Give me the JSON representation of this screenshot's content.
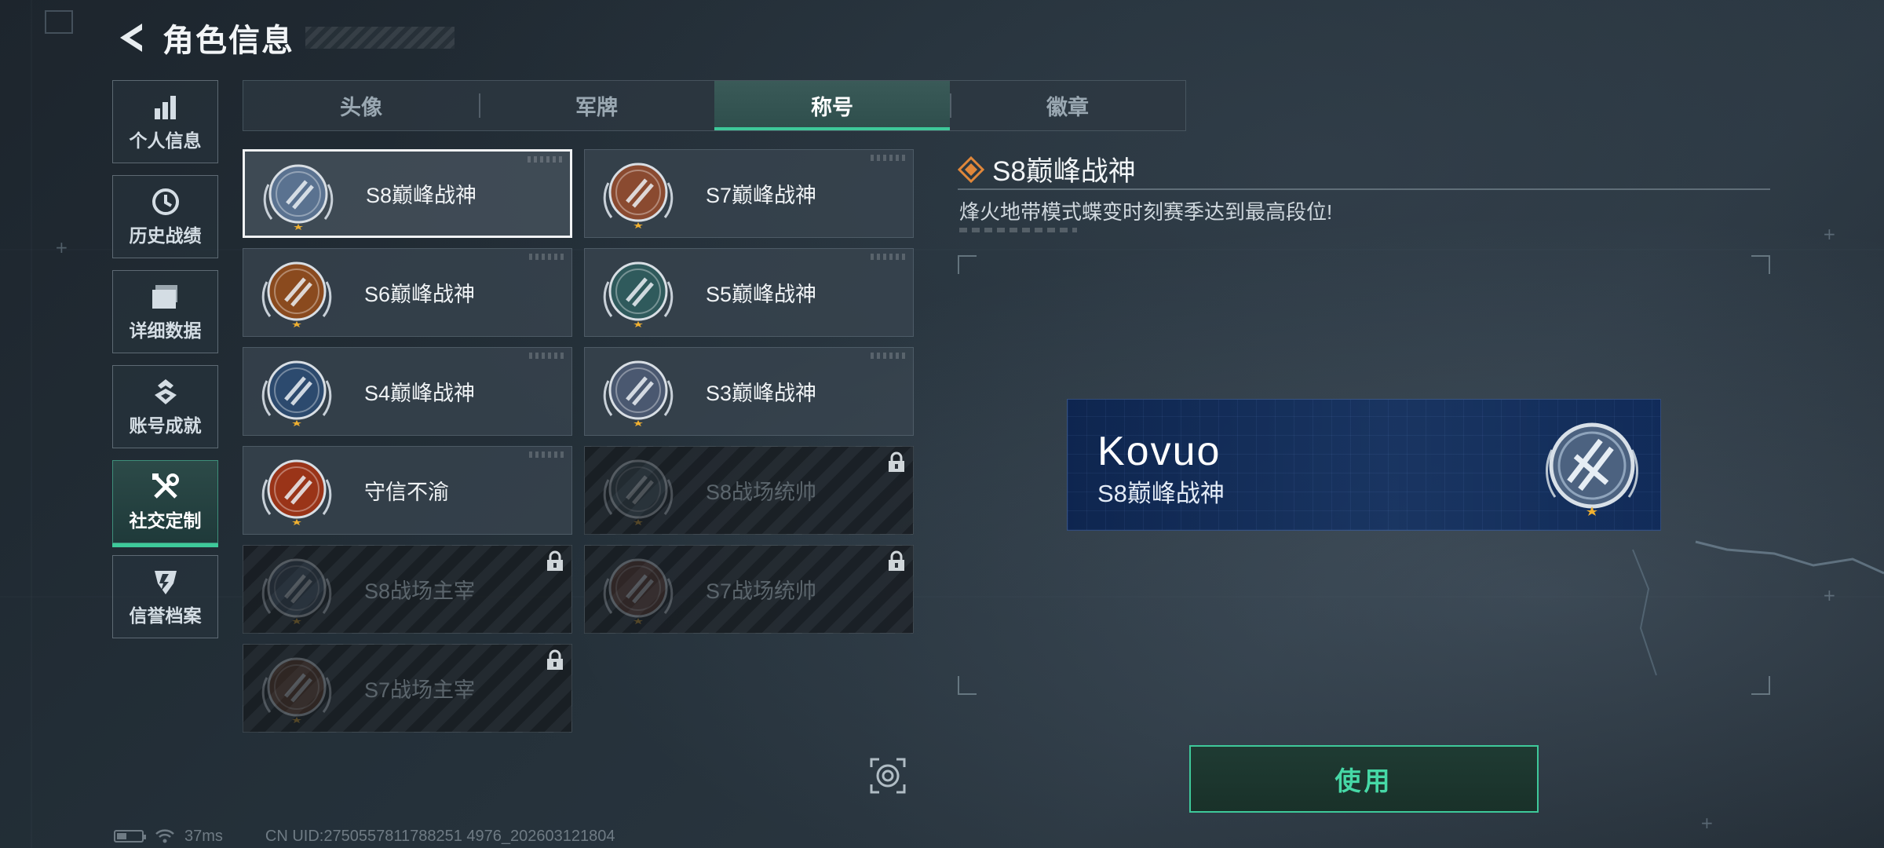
{
  "header": {
    "title": "角色信息"
  },
  "nav": [
    {
      "label": "个人信息",
      "icon": "bar-chart-icon",
      "active": false
    },
    {
      "label": "历史战绩",
      "icon": "history-clock-icon",
      "active": false
    },
    {
      "label": "详细数据",
      "icon": "folder-icon",
      "active": false
    },
    {
      "label": "账号成就",
      "icon": "achievement-icon",
      "active": false
    },
    {
      "label": "社交定制",
      "icon": "wrench-tools-icon",
      "active": true
    },
    {
      "label": "信誉档案",
      "icon": "credit-shield-icon",
      "active": false
    }
  ],
  "tabs": [
    {
      "label": "头像",
      "active": false
    },
    {
      "label": "军牌",
      "active": false
    },
    {
      "label": "称号",
      "active": true
    },
    {
      "label": "徽章",
      "active": false
    }
  ],
  "titles": [
    {
      "name": "S8巅峰战神",
      "badge": "s8-emblem-icon",
      "locked": false,
      "selected": true,
      "color": "#5a7290"
    },
    {
      "name": "S7巅峰战神",
      "badge": "gun-emblem-icon",
      "locked": false,
      "selected": false,
      "color": "#8a4a30"
    },
    {
      "name": "S6巅峰战神",
      "badge": "t-emblem-icon",
      "locked": false,
      "selected": false,
      "color": "#8a4a1e"
    },
    {
      "name": "S5巅峰战神",
      "badge": "diver-skull-icon",
      "locked": false,
      "selected": false,
      "color": "#2f5a5c"
    },
    {
      "name": "S4巅峰战神",
      "badge": "helmet-emblem-icon",
      "locked": false,
      "selected": false,
      "color": "#2c4a6e"
    },
    {
      "name": "S3巅峰战神",
      "badge": "globe-emblem-icon",
      "locked": false,
      "selected": false,
      "color": "#4a5870"
    },
    {
      "name": "守信不渝",
      "badge": "scales-emblem-icon",
      "locked": false,
      "selected": false,
      "color": "#9a3418"
    },
    {
      "name": "S8战场统帅",
      "badge": "tank-emblem-icon",
      "locked": true,
      "selected": false,
      "color": "#3a4a55"
    },
    {
      "name": "S8战场主宰",
      "badge": "building-emblem-icon",
      "locked": true,
      "selected": false,
      "color": "#3a4a60"
    },
    {
      "name": "S7战场统帅",
      "badge": "vehicle-emblem-icon",
      "locked": true,
      "selected": false,
      "color": "#6a3a2a"
    },
    {
      "name": "S7战场主宰",
      "badge": "soldier-emblem-icon",
      "locked": true,
      "selected": false,
      "color": "#6a3a22"
    }
  ],
  "detail": {
    "title": "S8巅峰战神",
    "description": "烽火地带模式蝶变时刻赛季达到最高段位!"
  },
  "preview": {
    "player_name": "Kovuo",
    "title": "S8巅峰战神"
  },
  "use_button": "使用",
  "status": {
    "ping": "37ms",
    "uid": "CN UID:2750557811788251 4976_202603121804"
  },
  "colors": {
    "accent": "#3ec99a",
    "detail_icon": "#e0873a"
  }
}
